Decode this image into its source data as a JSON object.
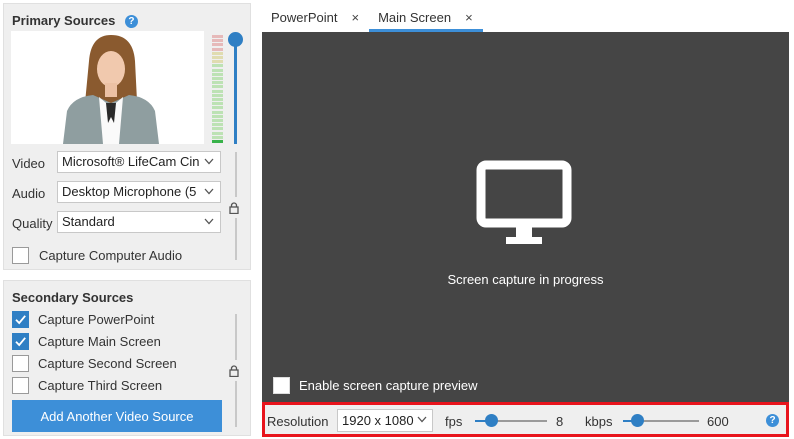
{
  "primary": {
    "title": "Primary Sources",
    "help_icon": "?",
    "video_label": "Video",
    "video_value": "Microsoft® LifeCam Cin",
    "audio_label": "Audio",
    "audio_value": "Desktop Microphone (5",
    "quality_label": "Quality",
    "quality_value": "Standard",
    "capture_audio_label": "Capture Computer Audio",
    "capture_audio_checked": false,
    "volume_level": 1.0
  },
  "secondary": {
    "title": "Secondary Sources",
    "items": [
      {
        "label": "Capture PowerPoint",
        "checked": true
      },
      {
        "label": "Capture Main Screen",
        "checked": true
      },
      {
        "label": "Capture Second Screen",
        "checked": false
      },
      {
        "label": "Capture Third Screen",
        "checked": false
      }
    ],
    "add_button": "Add Another Video Source"
  },
  "tabs": [
    {
      "label": "PowerPoint",
      "close": "×",
      "active": false
    },
    {
      "label": "Main Screen",
      "close": "×",
      "active": true
    }
  ],
  "stage": {
    "message": "Screen capture in progress",
    "preview_label": "Enable screen capture preview",
    "preview_checked": false
  },
  "bottom": {
    "resolution_label": "Resolution",
    "resolution_value": "1920 x 1080",
    "fps_label": "fps",
    "fps_value": "8",
    "fps_fraction": 0.22,
    "kbps_label": "kbps",
    "kbps_value": "600",
    "kbps_fraction": 0.18,
    "help_icon": "?"
  },
  "colors": {
    "accent": "#2f7fc4",
    "button": "#3d8fd8",
    "highlight_border": "#e8141c",
    "stage_bg": "#454545"
  }
}
